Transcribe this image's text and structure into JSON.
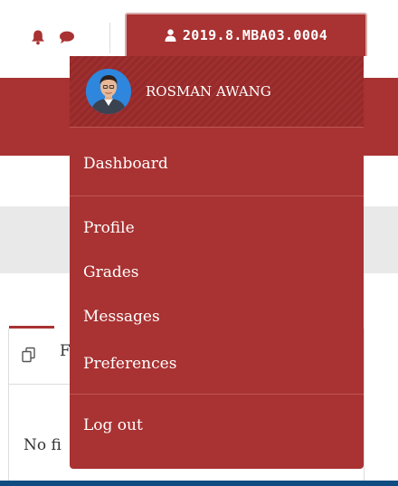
{
  "navbar": {
    "user_id": "2019.8.MBA03.0004",
    "icons": [
      "bell-icon",
      "chat-icon",
      "user-icon"
    ]
  },
  "user_menu": {
    "name": "ROSMAN AWANG",
    "items": [
      {
        "label": "Dashboard"
      },
      {
        "label": "Profile"
      },
      {
        "label": "Grades"
      },
      {
        "label": "Messages"
      },
      {
        "label": "Preferences"
      },
      {
        "label": "Log out"
      }
    ]
  },
  "background": {
    "tab_label": "F",
    "empty_text": "No fi"
  },
  "colors": {
    "primary": "#a93232",
    "header_stripe": "#942a2a",
    "separator": "#bf5656",
    "gray_band": "#e9e9e9",
    "bottom_bar": "#0f4c81"
  }
}
